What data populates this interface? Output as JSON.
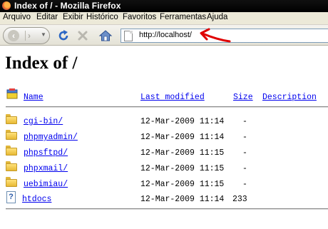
{
  "window": {
    "title": "Index of / - Mozilla Firefox"
  },
  "menu": {
    "items": [
      {
        "label": "Arquivo"
      },
      {
        "label": "Editar"
      },
      {
        "label": "Exibir"
      },
      {
        "label": "Histórico"
      },
      {
        "label": "Favoritos"
      },
      {
        "label": "Ferramentas"
      },
      {
        "label": "Ajuda"
      }
    ]
  },
  "toolbar": {
    "url": "http://localhost/",
    "icons": [
      "back-icon",
      "forward-icon",
      "history-dropdown-icon",
      "reload-icon",
      "stop-icon",
      "home-icon",
      "page-icon",
      "red-arrow-annotation"
    ]
  },
  "page": {
    "heading": "Index of /",
    "columns": {
      "name": "Name",
      "modified": "Last modified",
      "size": "Size",
      "description": "Description"
    },
    "rows": [
      {
        "name": "cgi-bin/",
        "modified": "12-Mar-2009 11:14",
        "size": "-",
        "icon": "folder-icon"
      },
      {
        "name": "phpmyadmin/",
        "modified": "12-Mar-2009 11:14",
        "size": "-",
        "icon": "folder-icon"
      },
      {
        "name": "phpsftpd/",
        "modified": "12-Mar-2009 11:15",
        "size": "-",
        "icon": "folder-icon"
      },
      {
        "name": "phpxmail/",
        "modified": "12-Mar-2009 11:15",
        "size": "-",
        "icon": "folder-icon"
      },
      {
        "name": "uebimiau/",
        "modified": "12-Mar-2009 11:15",
        "size": "-",
        "icon": "folder-icon"
      },
      {
        "name": "htdocs",
        "modified": "12-Mar-2009 11:14",
        "size": "233",
        "icon": "unknown-file-icon"
      }
    ]
  },
  "colors": {
    "link": "#0000ee",
    "titlebar": "#000000",
    "menubar": "#ece9d8",
    "annotation_arrow": "#e00000"
  }
}
